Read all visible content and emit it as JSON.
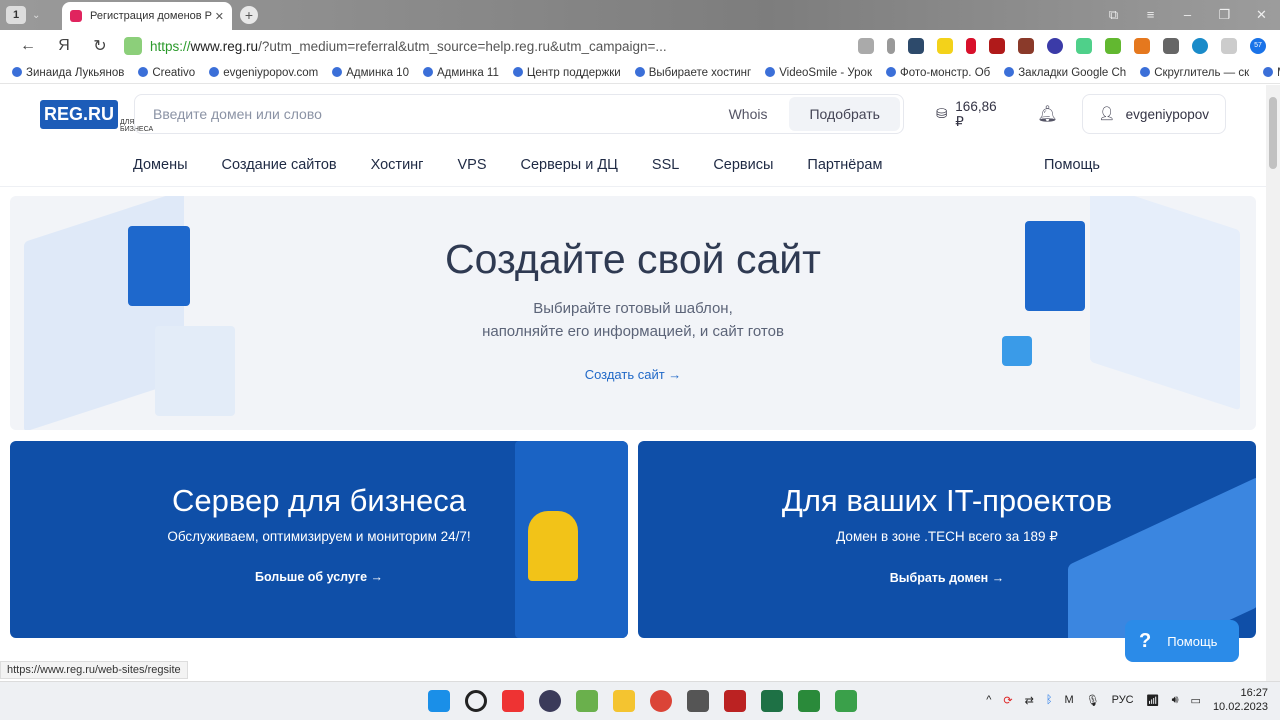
{
  "browser": {
    "tab_count": "1",
    "tab_title": "Регистрация доменов Р",
    "url_scheme": "https://",
    "url_host": "www.reg.ru",
    "url_rest": "/?utm_medium=referral&utm_source=help.reg.ru&utm_campaign=...",
    "bookmarks": [
      "Зинаида Лукьянов",
      "Creativo",
      "evgeniypopov.com",
      "Админка 10",
      "Админка 11",
      "Центр поддержки",
      "Выбираете хостинг",
      "VideoSmile - Урок",
      "Фото-монстр. Об",
      "Закладки Google Ch",
      "Скруглитель — ск",
      "Мои"
    ],
    "status_url": "https://www.reg.ru/web-sites/regsite",
    "downloads_badge": "57"
  },
  "header": {
    "logo": "REG.RU",
    "logo_sub": "ДЛЯ БИЗНЕСА",
    "search_placeholder": "Введите домен или слово",
    "whois": "Whois",
    "pick": "Подобрать",
    "balance": "166,86 ₽",
    "username": "evgeniypopov"
  },
  "menu": [
    "Домены",
    "Создание сайтов",
    "Хостинг",
    "VPS",
    "Серверы и ДЦ",
    "SSL",
    "Сервисы",
    "Партнёрам"
  ],
  "menu_help": "Помощь",
  "hero": {
    "title": "Создайте свой сайт",
    "line1": "Выбирайте готовый шаблон,",
    "line2": "наполняйте его информацией, и сайт готов",
    "link": "Создать сайт →"
  },
  "cards": [
    {
      "title": "Сервер для бизнеса",
      "subtitle": "Обслуживаем, оптимизируем и мониторим 24/7!",
      "link": "Больше об услуге →"
    },
    {
      "title": "Для ваших IT-проектов",
      "subtitle": "Домен в зоне .TECH всего за 189 ₽",
      "link": "Выбрать домен →"
    }
  ],
  "help_button": "Помощь",
  "taskbar": {
    "lang": "РУС",
    "time": "16:27",
    "date": "10.02.2023"
  }
}
